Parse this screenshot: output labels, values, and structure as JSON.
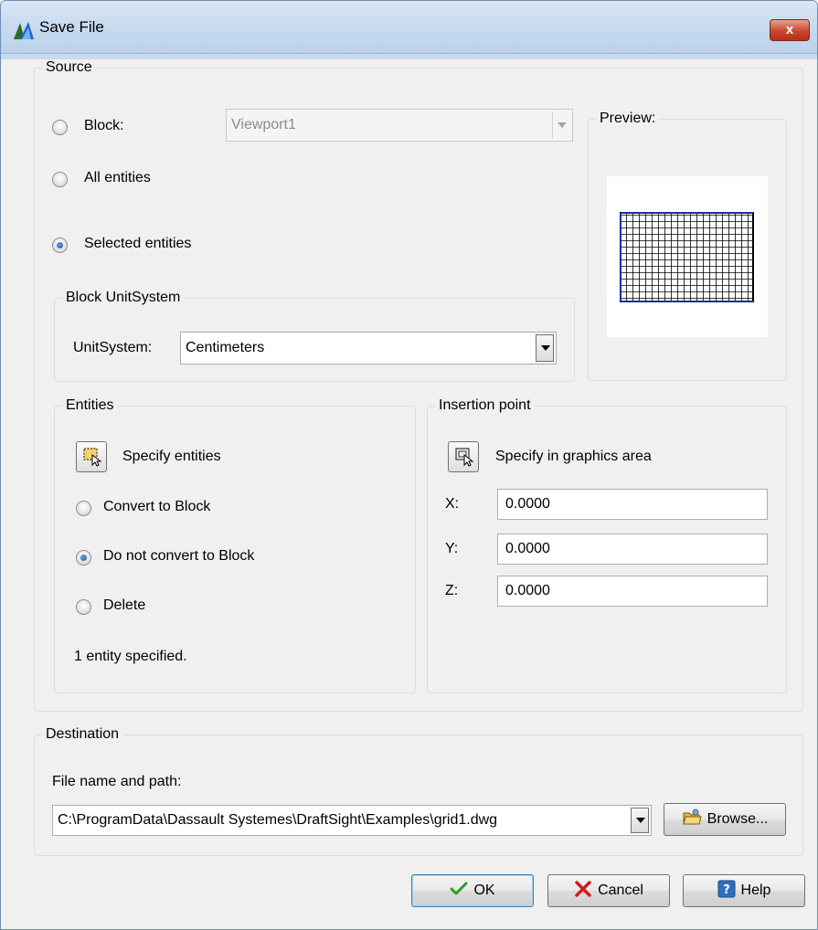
{
  "window": {
    "title": "Save File",
    "close_label": "x"
  },
  "source": {
    "legend": "Source",
    "radios": {
      "block": "Block:",
      "all": "All entities",
      "selected": "Selected entities"
    },
    "selected_radio": "selected",
    "block_combo": {
      "value": "Viewport1",
      "enabled": false
    },
    "unit_group": {
      "legend": "Block UnitSystem",
      "label": "UnitSystem:",
      "value": "Centimeters"
    },
    "preview": {
      "legend": "Preview:"
    },
    "entities": {
      "legend": "Entities",
      "specify_label": "Specify entities",
      "options": [
        "Convert to Block",
        "Do not convert to Block",
        "Delete"
      ],
      "selected_option": 1,
      "status": "1 entity specified."
    },
    "insertion": {
      "legend": "Insertion point",
      "specify_label": "Specify in graphics area",
      "x_label": "X:",
      "x_value": "0.0000",
      "y_label": "Y:",
      "y_value": "0.0000",
      "z_label": "Z:",
      "z_value": "0.0000"
    }
  },
  "destination": {
    "legend": "Destination",
    "path_label": "File name and path:",
    "path_value": "C:\\ProgramData\\Dassault Systemes\\DraftSight\\Examples\\grid1.dwg",
    "browse_label": "Browse..."
  },
  "buttons": {
    "ok": "OK",
    "cancel": "Cancel",
    "help": "Help"
  },
  "icons": {
    "app": "draftsight-app-icon",
    "pick": "select-entities-icon",
    "point": "pick-point-icon",
    "browse": "folder-icon",
    "ok": "checkmark-icon",
    "cancel": "red-x-icon",
    "help": "question-icon"
  },
  "colors": {
    "title_bar": "#c9dbef",
    "close": "#c9462d",
    "ok_check": "#2a9d2a",
    "cancel_x": "#d11a1a",
    "help": "#2f6fbf"
  }
}
